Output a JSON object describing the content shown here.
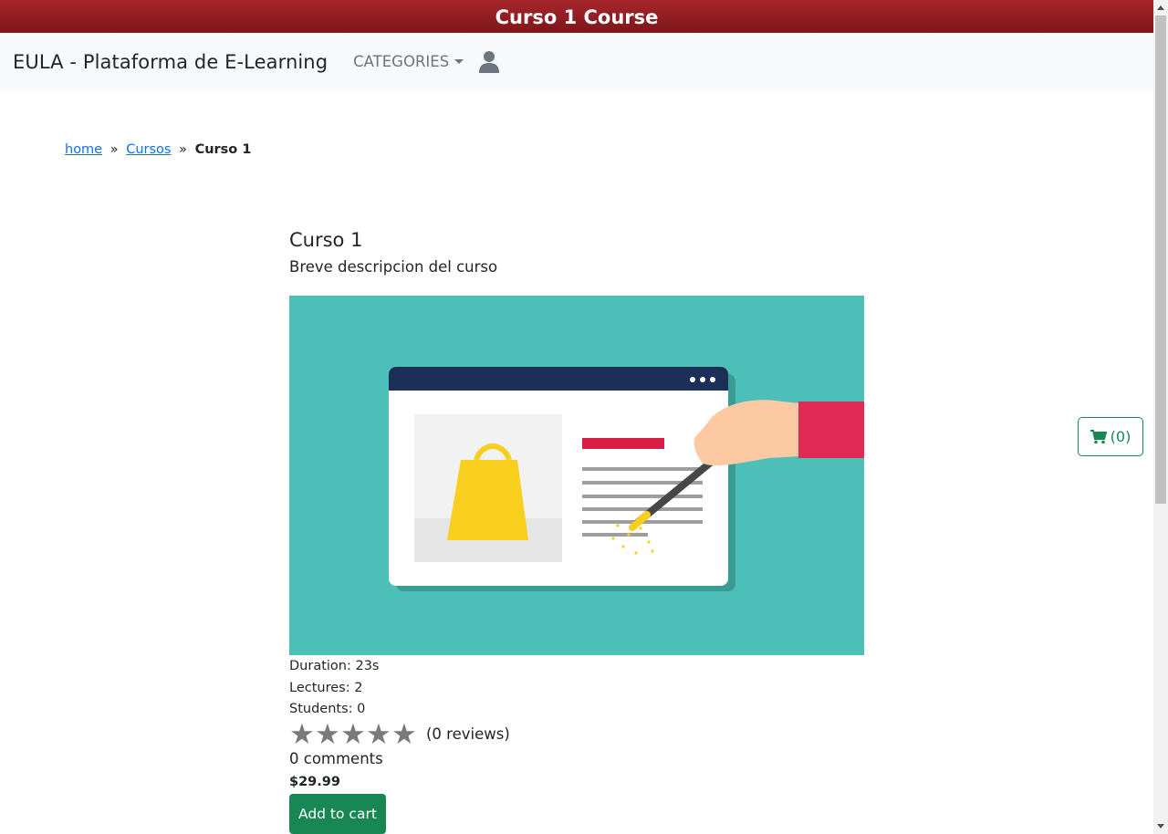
{
  "banner": {
    "title": "Curso 1 Course"
  },
  "navbar": {
    "brand": "EULA - Plataforma de E-Learning",
    "categories_label": "CATEGORIES"
  },
  "breadcrumb": {
    "home": "home",
    "sep1": "»",
    "cursos": "Cursos",
    "sep2": "»",
    "current": "Curso 1"
  },
  "course": {
    "title": "Curso 1",
    "description": "Breve descripcion del curso",
    "duration": "Duration: 23s",
    "lectures": "Lectures: 2",
    "students": "Students: 0",
    "rating_stars": 0,
    "reviews": "(0 reviews)",
    "comments": "0 comments",
    "price": "$29.99",
    "add_to_cart": "Add to cart"
  },
  "cart": {
    "count_label": "(0)"
  },
  "colors": {
    "banner": "#8f1d22",
    "navbar_bg": "#f8f9fa",
    "link": "#0d6efd",
    "success": "#198754",
    "image_bg": "#4bbfb8",
    "star": "#7a7a7a"
  },
  "icons": [
    "user-icon",
    "caret-down-icon",
    "star-icon",
    "cart-icon",
    "scroll-up-arrow-icon",
    "scroll-down-arrow-icon"
  ]
}
